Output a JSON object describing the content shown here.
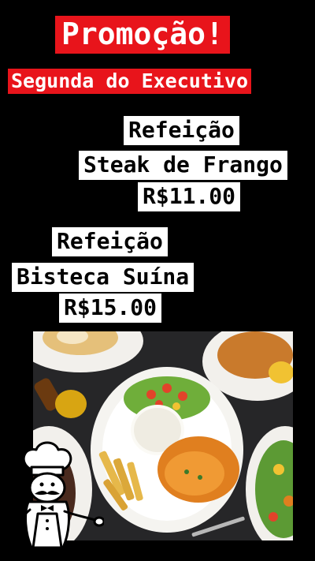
{
  "header": {
    "title": "Promoção!",
    "subtitle": "Segunda do Executivo"
  },
  "menu": [
    {
      "line1": "Refeição",
      "line2": "Steak de Frango",
      "price": "R$11.00"
    },
    {
      "line1": "Refeição",
      "line2": "Bisteca Suína",
      "price": "R$15.00"
    }
  ],
  "colors": {
    "background": "#000000",
    "accent_red": "#e8141b",
    "label_white": "#ffffff"
  },
  "icons": {
    "logo": "chef-mascot-icon"
  }
}
